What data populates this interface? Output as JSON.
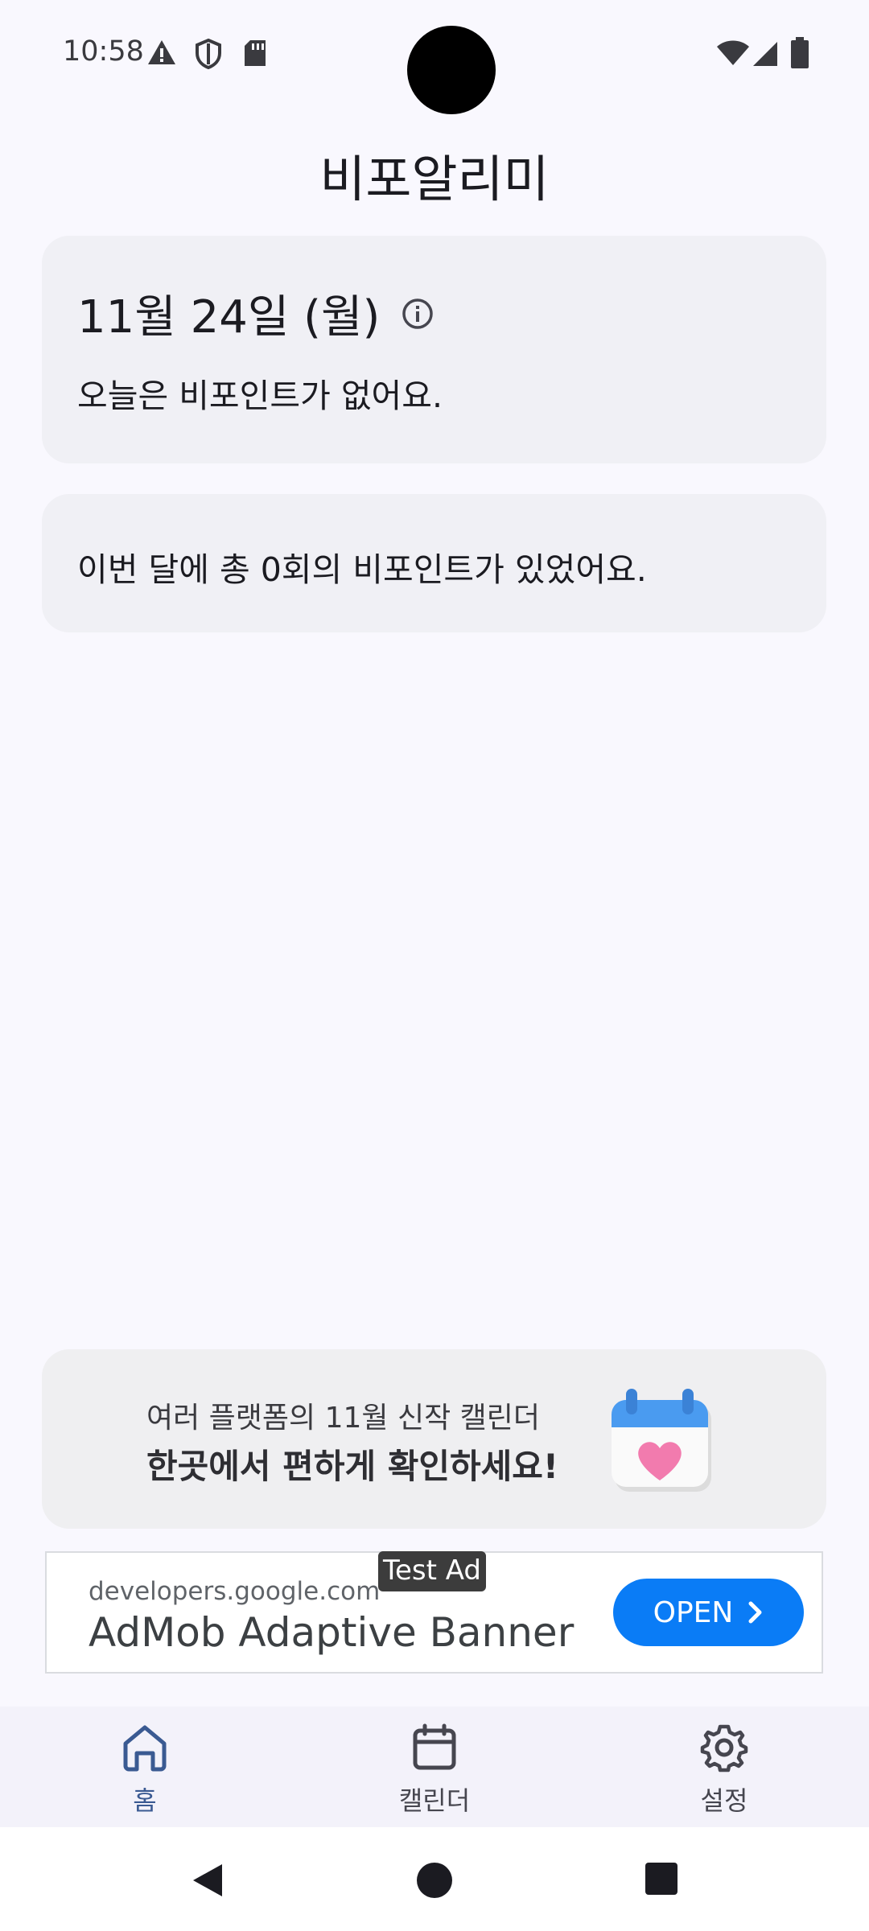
{
  "status_bar": {
    "time": "10:58",
    "left_icons": [
      "warning-icon",
      "shield-icon",
      "sd-card-icon"
    ],
    "right_icons": [
      "wifi-icon",
      "cellular-icon",
      "battery-icon"
    ]
  },
  "app": {
    "title": "비포알리미"
  },
  "today_card": {
    "date": "11월 24일 (월)",
    "message": "오늘은 비포인트가 없어요."
  },
  "month_card": {
    "message": "이번 달에 총 0회의 비포인트가 있었어요."
  },
  "promo": {
    "line1": "여러 플랫폼의 11월 신작 캘린더",
    "line2": "한곳에서 편하게 확인하세요!",
    "image_icon": "calendar-heart-icon"
  },
  "ad": {
    "tag": "Test Ad",
    "domain": "developers.google.com",
    "title": "AdMob Adaptive Banner",
    "cta": "OPEN"
  },
  "bottom_nav": {
    "items": [
      {
        "label": "홈",
        "icon": "home-icon",
        "active": true
      },
      {
        "label": "캘린더",
        "icon": "calendar-icon",
        "active": false
      },
      {
        "label": "설정",
        "icon": "gear-icon",
        "active": false
      }
    ]
  },
  "system_nav": {
    "buttons": [
      "back-icon",
      "home-circle-icon",
      "recents-icon"
    ]
  },
  "colors": {
    "background": "#F9F8FE",
    "card": "#F0F0F5",
    "accent": "#3A5A92",
    "ad_button": "#0A7CF6"
  }
}
